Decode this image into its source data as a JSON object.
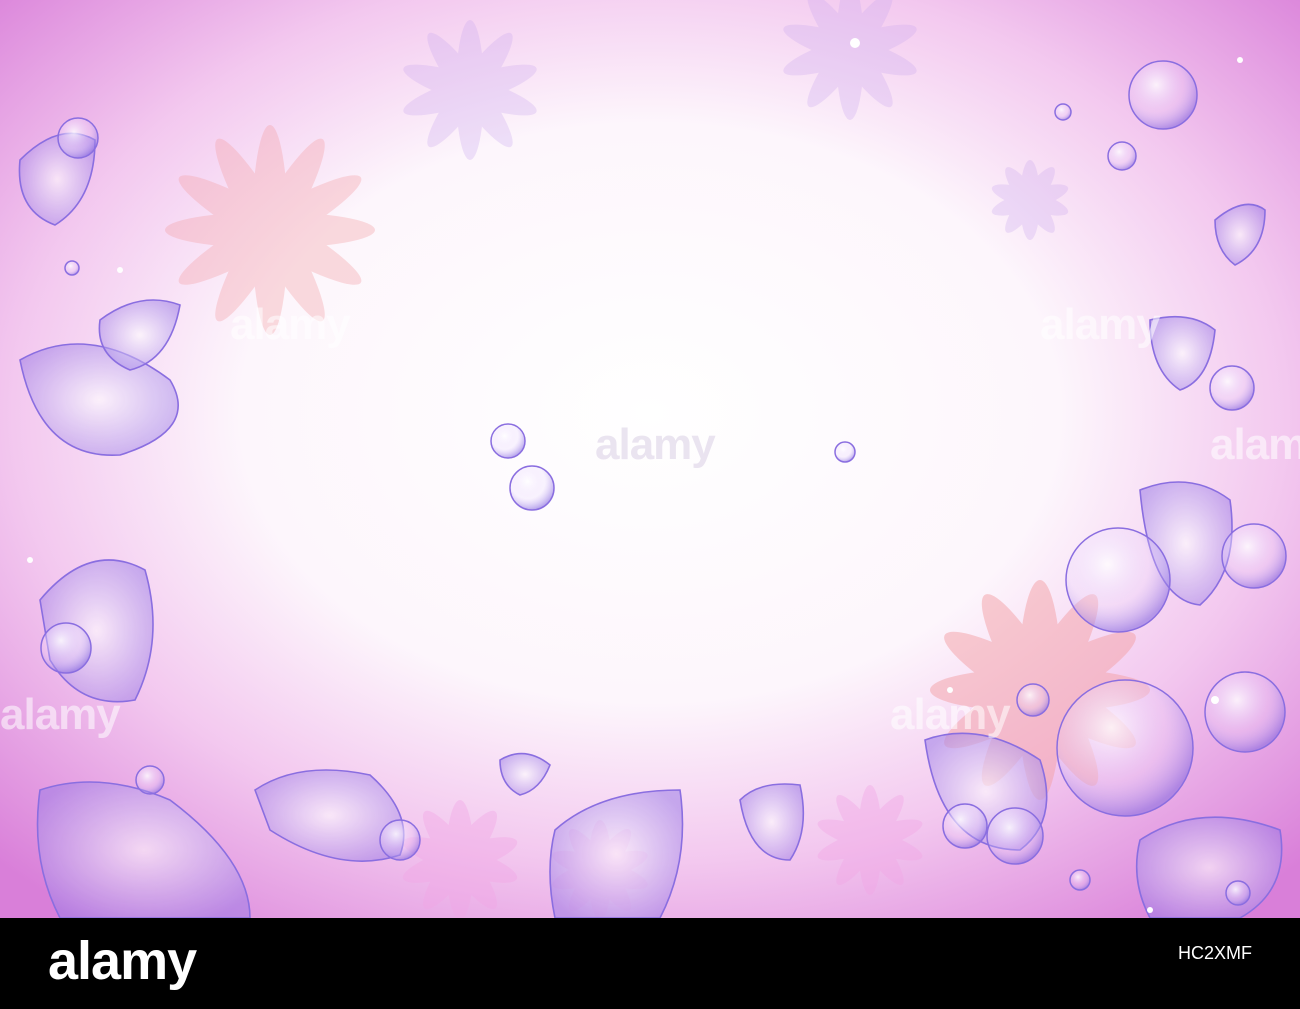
{
  "image": {
    "description_colors": {
      "pink": "#f2a6e6",
      "violet": "#9a7be0",
      "coral": "#f4a1a6",
      "white": "#ffffff",
      "footer": "#000000"
    }
  },
  "watermark": {
    "text": "alamy"
  },
  "footer": {
    "logo": "alamy",
    "stock_label": "",
    "image_id": "HC2XMF"
  }
}
